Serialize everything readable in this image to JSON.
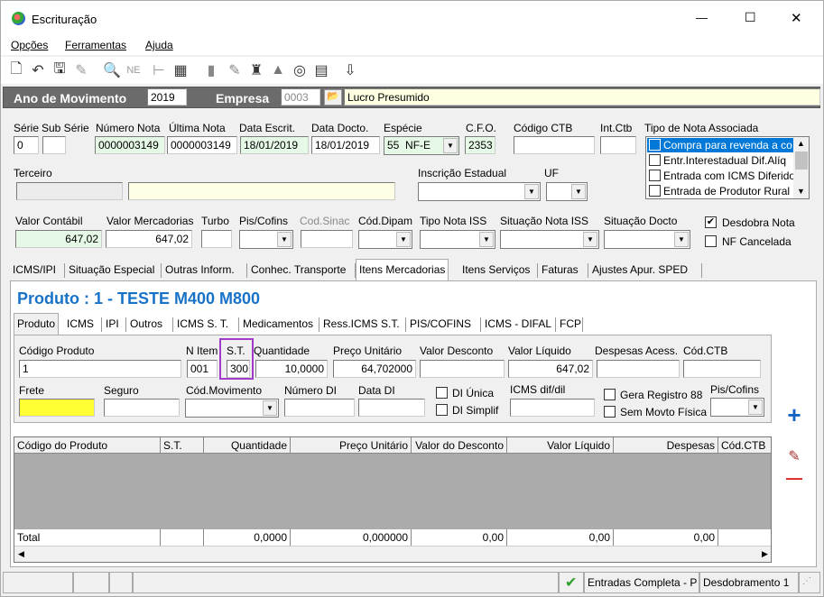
{
  "window": {
    "title": "Escrituração",
    "minimize": "—",
    "maximize": "☐",
    "close": "✕"
  },
  "menu": [
    "Opções",
    "Ferramentas",
    "Ajuda"
  ],
  "header": {
    "ano_label": "Ano de Movimento",
    "ano_value": "2019",
    "empresa_label": "Empresa",
    "empresa_code": "0003",
    "empresa_name": "Lucro Presumido"
  },
  "row1": {
    "serie_label": "Série",
    "serie_value": "0",
    "subserie_label": "Sub Série",
    "subserie_value": "",
    "numero_label": "Número Nota",
    "numero_value": "0000003149",
    "ultima_label": "Última Nota",
    "ultima_value": "0000003149",
    "dataescrit_label": "Data Escrit.",
    "dataescrit_value": "18/01/2019",
    "datadocto_label": "Data Docto.",
    "datadocto_value": "18/01/2019",
    "especie_label": "Espécie",
    "especie_code": "55",
    "especie_value": "NF-E",
    "cfo_label": "C.F.O.",
    "cfo_value": "2353",
    "ctb_label": "Código CTB",
    "ctb_value": "",
    "intctb_label": "Int.Ctb",
    "intctb_value": "",
    "tipo_label": "Tipo de Nota Associada"
  },
  "tipo_nota_items": [
    "Compra para revenda a co",
    "Entr.Interestadual Dif.Alíq",
    "Entrada com ICMS Diferido",
    "Entrada de Produtor Rural"
  ],
  "row2": {
    "terceiro_label": "Terceiro",
    "inscricao_label": "Inscrição Estadual",
    "uf_label": "UF"
  },
  "row3": {
    "valorcontabil_label": "Valor Contábil",
    "valorcontabil_value": "647,02",
    "valormerc_label": "Valor Mercadorias",
    "valormerc_value": "647,02",
    "turbo_label": "Turbo",
    "piscofins_label": "Pis/Cofins",
    "codsinac_label": "Cod.Sinac",
    "coddipam_label": "Cód.Dipam",
    "tipoiss_label": "Tipo Nota ISS",
    "situacaoiss_label": "Situação Nota ISS",
    "situacaodocto_label": "Situação Docto",
    "desdobra_label": "Desdobra Nota",
    "cancelada_label": "NF Cancelada"
  },
  "main_tabs": [
    "ICMS/IPI",
    "Situação Especial",
    "Outras Inform.",
    "Conhec. Transporte",
    "Itens Mercadorias",
    "Itens Serviços",
    "Faturas",
    "Ajustes Apur. SPED"
  ],
  "produto_title": "Produto : 1 - TESTE M400 M800",
  "sub_tabs": [
    "Produto",
    "ICMS",
    "IPI",
    "Outros",
    "ICMS S. T.",
    "Medicamentos",
    "Ress.ICMS S.T.",
    "PIS/COFINS",
    "ICMS - DIFAL",
    "FCP"
  ],
  "produto": {
    "codigo_label": "Código Produto",
    "codigo_value": "1",
    "nitem_label": "N Item",
    "nitem_value": "001",
    "st_label": "S.T.",
    "st_value": "300",
    "quantidade_label": "Quantidade",
    "quantidade_value": "10,0000",
    "preco_label": "Preço Unitário",
    "preco_value": "64,702000",
    "desconto_label": "Valor Desconto",
    "liquido_label": "Valor Líquido",
    "liquido_value": "647,02",
    "despesas_label": "Despesas Acess.",
    "codctb_label": "Cód.CTB",
    "frete_label": "Frete",
    "seguro_label": "Seguro",
    "codmov_label": "Cód.Movimento",
    "numerodi_label": "Número DI",
    "datadi_label": "Data DI",
    "diunica_label": "DI Única",
    "disimplif_label": "DI Simplif",
    "icmsdif_label": "ICMS dif/dil",
    "gera88_label": "Gera Registro 88",
    "semmovto_label": "Sem Movto Física",
    "piscofins_label": "Pis/Cofins"
  },
  "grid": {
    "columns": [
      "Código do Produto",
      "S.T.",
      "Quantidade",
      "Preço Unitário",
      "Valor do Desconto",
      "Valor Líquido",
      "Despesas",
      "Cód.CTB"
    ],
    "total_label": "Total",
    "totals": [
      "0,0000",
      "0,000000",
      "0,00",
      "0,00",
      "0,00"
    ]
  },
  "side_buttons": {
    "add": "+",
    "remove": "—"
  },
  "status": {
    "entradas": "Entradas Completa - P",
    "desdobramento": "Desdobramento 1"
  }
}
